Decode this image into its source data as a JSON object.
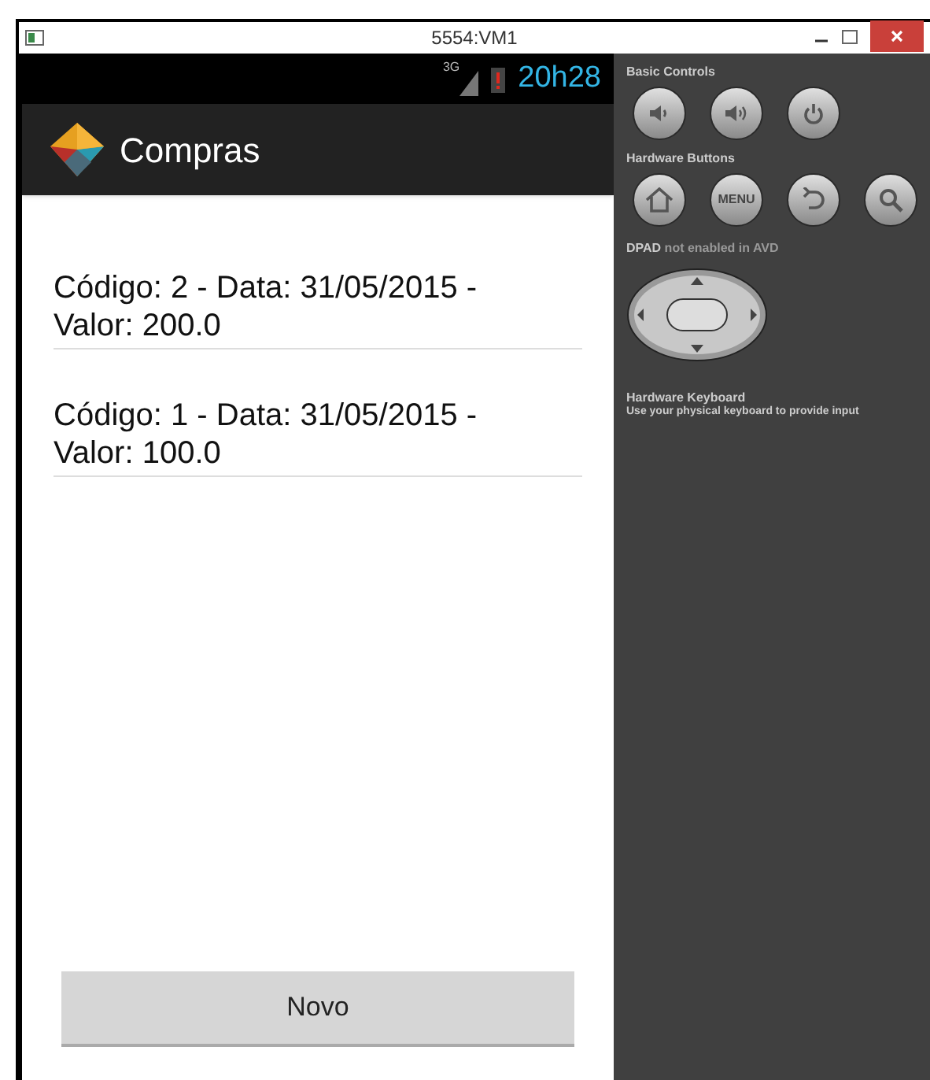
{
  "window": {
    "title": "5554:VM1"
  },
  "status_bar": {
    "network": "3G",
    "time": "20h28"
  },
  "action_bar": {
    "title": "Compras"
  },
  "list": [
    {
      "text": "Código: 2 - Data: 31/05/2015 - Valor: 200.0"
    },
    {
      "text": "Código: 1 - Data: 31/05/2015 - Valor: 100.0"
    }
  ],
  "button": {
    "label": "Novo"
  },
  "controls": {
    "basic_title": "Basic Controls",
    "hardware_title": "Hardware Buttons",
    "menu_label": "MENU",
    "dpad_note": "**DPAD** not enabled in AVD",
    "keyboard_title": "Hardware Keyboard",
    "keyboard_note": "Use your physical keyboard to provide input"
  }
}
